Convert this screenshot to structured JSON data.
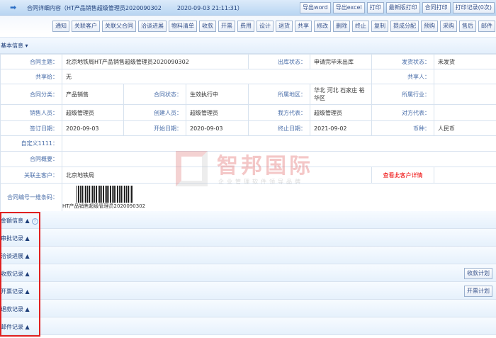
{
  "header": {
    "title": "合同详细内容（HT产品销售超级管理员2020090302",
    "datetime": "2020-09-03 21:11:31）",
    "buttons": [
      "导出word",
      "导出excel",
      "打印",
      "最新版打印",
      "合同打印",
      "打印记录(0次)"
    ]
  },
  "toolbar": [
    "通知",
    "关联客户",
    "关联父合同",
    "洽谈进展",
    "物料清单",
    "收款",
    "开票",
    "费用",
    "设计",
    "退货",
    "共享",
    "修改",
    "删除",
    "终止",
    "复制",
    "提成分配",
    "预购",
    "采购",
    "售后",
    "邮件"
  ],
  "basic": {
    "title": "基本信息 ▾",
    "rows": [
      {
        "a": "合同主题：",
        "b": "北京地铁局HT产品销售超级管理员2020090302",
        "c": "出库状态：",
        "d": "申请完毕未出库",
        "e": "发货状态：",
        "f": "未发货"
      },
      {
        "a": "共享给：",
        "b": "无",
        "e": "共享人：",
        "f": ""
      },
      {
        "a": "合同分类：",
        "b": "产品销售",
        "c": "合同状态：",
        "d": "生效执行中",
        "e": "所属地区：",
        "f": "华北 河北 石家庄 裕华区",
        "g": "所属行业：",
        "h": ""
      },
      {
        "a": "销售人员：",
        "b": "超级管理员",
        "c": "创建人员：",
        "d": "超级管理员",
        "e": "我方代表：",
        "f": "超级管理员",
        "g": "对方代表：",
        "h": ""
      },
      {
        "a": "签订日期：",
        "b": "2020-09-03",
        "c": "开始日期：",
        "d": "2020-09-03",
        "e": "终止日期：",
        "f": "2021-09-02",
        "g": "币种：",
        "h": "人民币"
      }
    ],
    "custom_label": "自定义1111：",
    "summary_label": "合同概要：",
    "customer_label": "关联主客户：",
    "customer_value": "北京地铁局",
    "customer_link": "查看此客户详情",
    "barcode_label": "合同编号一维条码：",
    "barcode_text": "HT产品销售超级管理员2020090302"
  },
  "watermark": {
    "name": "智邦国际",
    "slogan": "企业管理软件领导品牌"
  },
  "sections": [
    {
      "label": "金额信息 ▲",
      "help": "?"
    },
    {
      "label": "审批记录 ▲"
    },
    {
      "label": "洽谈进展 ▲"
    },
    {
      "label": "收款记录 ▲",
      "button": "收款计划"
    },
    {
      "label": "开票记录 ▲",
      "button": "开票计划"
    },
    {
      "label": "退款记录 ▲"
    },
    {
      "label": "邮件记录 ▲"
    }
  ]
}
